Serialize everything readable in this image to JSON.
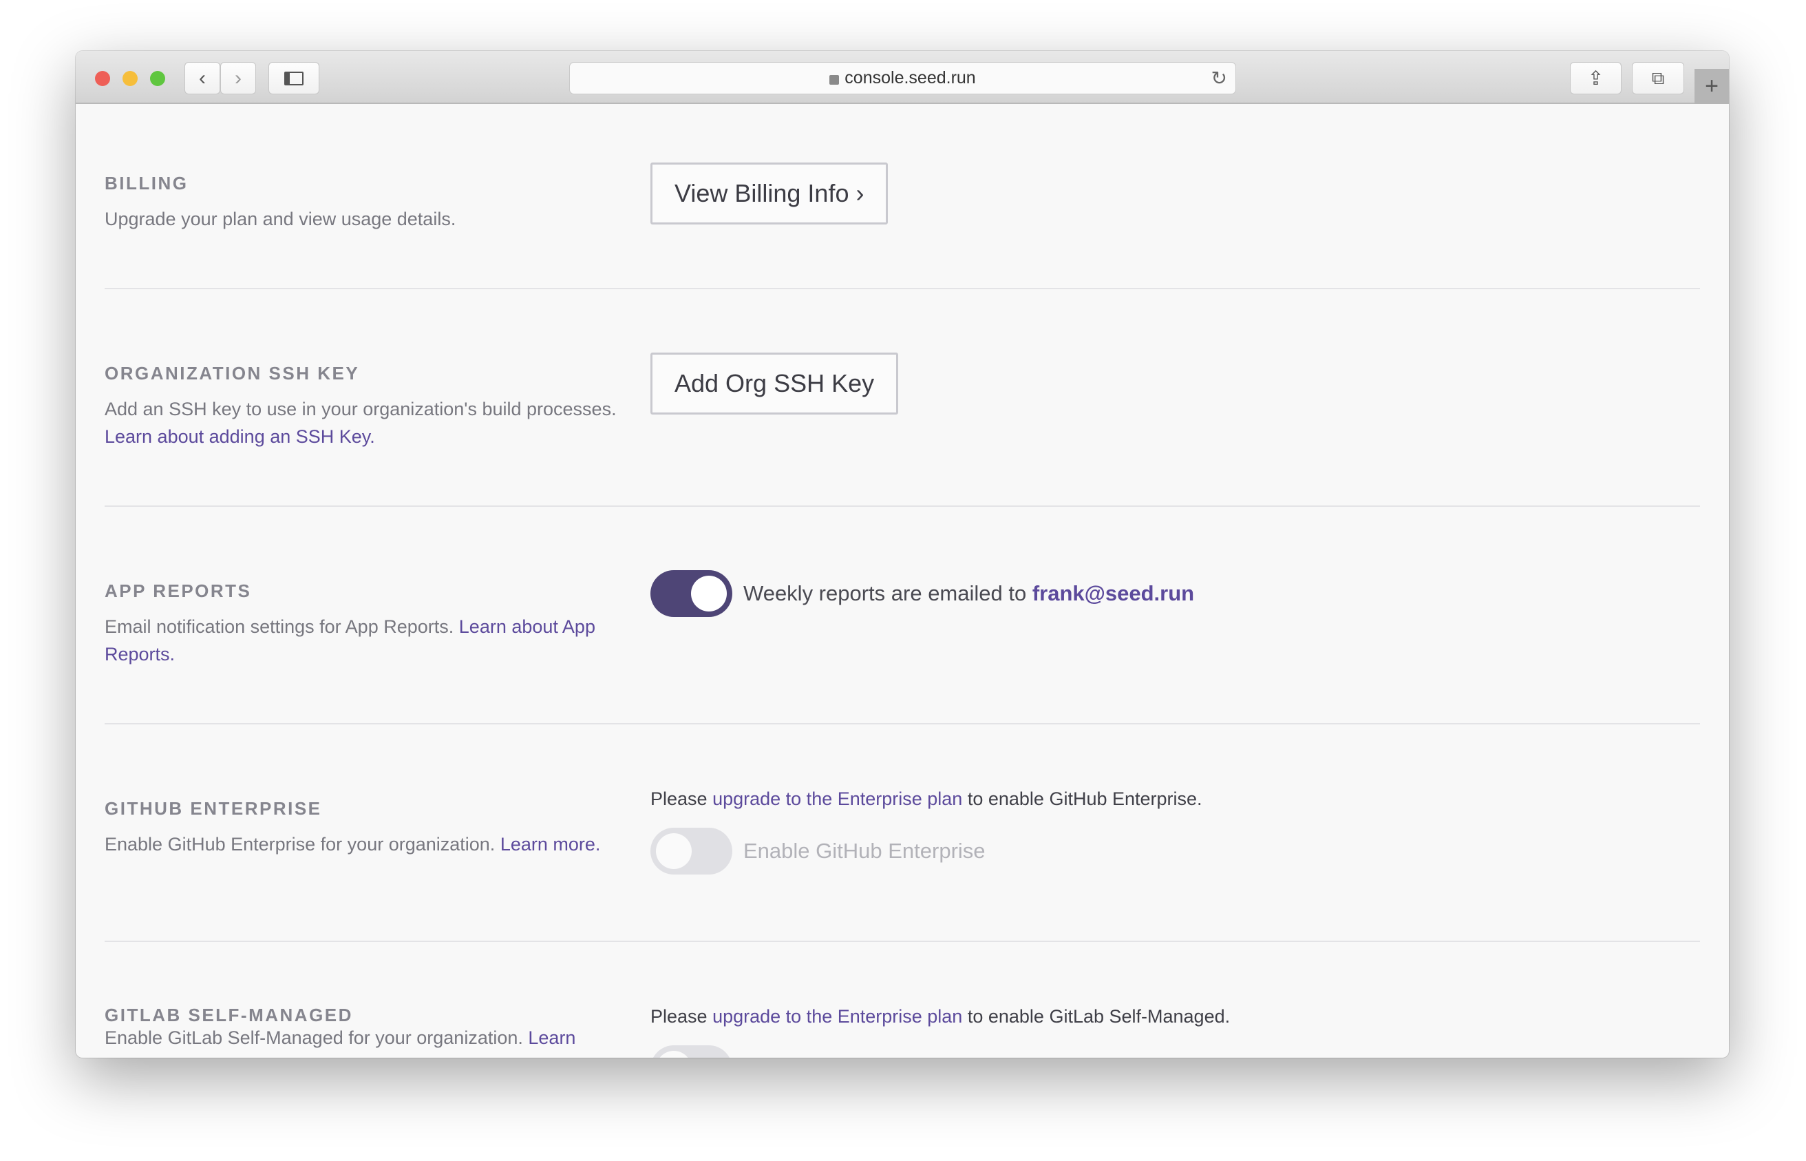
{
  "browser": {
    "url": "console.seed.run",
    "icons": {
      "close": "#ee5f57",
      "minimize": "#f6be3b",
      "zoom": "#5fc63f"
    }
  },
  "sections": [
    {
      "heading": "BILLING",
      "desc": "Upgrade your plan and view usage details.",
      "button": "View Billing Info ›"
    },
    {
      "heading": "ORGANIZATION SSH KEY",
      "desc": "Add an SSH key to use in your organization's build processes.",
      "link": "Learn about adding an SSH Key.",
      "button": "Add Org SSH Key"
    },
    {
      "heading": "APP REPORTS",
      "desc": "Email notification settings for App Reports.",
      "link": "Learn about App Reports.",
      "toggle_on": true,
      "toggle_label": "Weekly reports are emailed to",
      "email": "frank@seed.run"
    },
    {
      "heading": "GITHUB ENTERPRISE",
      "desc": "Enable GitHub Enterprise for your organization.",
      "link": "Learn more.",
      "notice_pre": "Please",
      "notice_link": "upgrade to the Enterprise plan",
      "notice_post": "to enable GitHub Enterprise.",
      "toggle_on": false,
      "toggle_label": "Enable GitHub Enterprise"
    },
    {
      "heading": "GITLAB SELF-MANAGED",
      "desc": "Enable GitLab Self-Managed for your organization.",
      "link": "Learn",
      "notice_pre": "Please",
      "notice_link": "upgrade to the Enterprise plan",
      "notice_post": "to enable GitLab Self-Managed.",
      "toggle_on": false
    }
  ],
  "colors": {
    "accent": "#4e4576",
    "link": "#5c4a9c"
  }
}
